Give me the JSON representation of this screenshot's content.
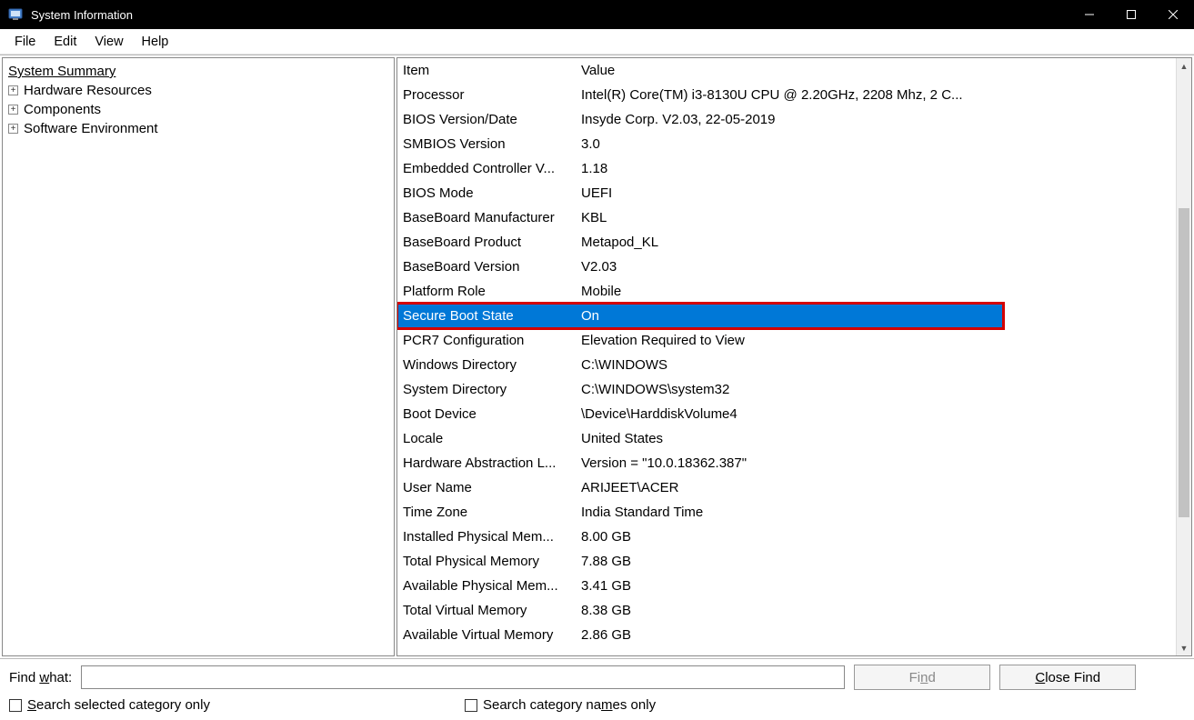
{
  "window": {
    "title": "System Information"
  },
  "menu": {
    "file": "File",
    "edit": "Edit",
    "view": "View",
    "help": "Help"
  },
  "tree": {
    "root": "System Summary",
    "nodes": [
      {
        "label": "Hardware Resources"
      },
      {
        "label": "Components"
      },
      {
        "label": "Software Environment"
      }
    ]
  },
  "columns": {
    "item": "Item",
    "value": "Value"
  },
  "rows": [
    {
      "item": "Processor",
      "value": "Intel(R) Core(TM) i3-8130U CPU @ 2.20GHz, 2208 Mhz, 2 C..."
    },
    {
      "item": "BIOS Version/Date",
      "value": "Insyde Corp. V2.03, 22-05-2019"
    },
    {
      "item": "SMBIOS Version",
      "value": "3.0"
    },
    {
      "item": "Embedded Controller V...",
      "value": "1.18"
    },
    {
      "item": "BIOS Mode",
      "value": "UEFI"
    },
    {
      "item": "BaseBoard Manufacturer",
      "value": "KBL"
    },
    {
      "item": "BaseBoard Product",
      "value": "Metapod_KL"
    },
    {
      "item": "BaseBoard Version",
      "value": "V2.03"
    },
    {
      "item": "Platform Role",
      "value": "Mobile"
    },
    {
      "item": "Secure Boot State",
      "value": "On",
      "selected": true,
      "highlighted": true
    },
    {
      "item": "PCR7 Configuration",
      "value": "Elevation Required to View"
    },
    {
      "item": "Windows Directory",
      "value": "C:\\WINDOWS"
    },
    {
      "item": "System Directory",
      "value": "C:\\WINDOWS\\system32"
    },
    {
      "item": "Boot Device",
      "value": "\\Device\\HarddiskVolume4"
    },
    {
      "item": "Locale",
      "value": "United States"
    },
    {
      "item": "Hardware Abstraction L...",
      "value": "Version = \"10.0.18362.387\""
    },
    {
      "item": "User Name",
      "value": "ARIJEET\\ACER"
    },
    {
      "item": "Time Zone",
      "value": "India Standard Time"
    },
    {
      "item": "Installed Physical Mem...",
      "value": "8.00 GB"
    },
    {
      "item": "Total Physical Memory",
      "value": "7.88 GB"
    },
    {
      "item": "Available Physical Mem...",
      "value": "3.41 GB"
    },
    {
      "item": "Total Virtual Memory",
      "value": "8.38 GB"
    },
    {
      "item": "Available Virtual Memory",
      "value": "2.86 GB"
    }
  ],
  "find": {
    "label_prefix": "Find ",
    "label_u": "w",
    "label_suffix": "hat:",
    "value": "",
    "find_prefix": "Fi",
    "find_u": "n",
    "find_suffix": "d",
    "close_u": "C",
    "close_suffix": "lose Find",
    "cb1_u": "S",
    "cb1_suffix": "earch selected category only",
    "cb2_prefix": "Search category na",
    "cb2_u": "m",
    "cb2_suffix": "es only"
  }
}
